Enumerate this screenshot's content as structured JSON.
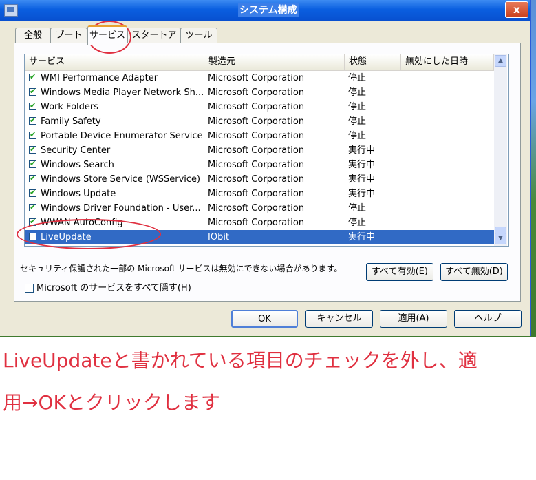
{
  "window": {
    "title": "システム構成",
    "close_label": "x"
  },
  "tabs": [
    {
      "label": "全般"
    },
    {
      "label": "ブート"
    },
    {
      "label": "サービス"
    },
    {
      "label": "スタートアップ"
    },
    {
      "label": "ツール"
    }
  ],
  "active_tab": "サービス",
  "table": {
    "columns": [
      "サービス",
      "製造元",
      "状態",
      "無効にした日時"
    ],
    "rows": [
      {
        "name": "WMI Performance Adapter",
        "manufacturer": "Microsoft Corporation",
        "status": "停止",
        "checked": true
      },
      {
        "name": "Windows Media Player Network Sh...",
        "manufacturer": "Microsoft Corporation",
        "status": "停止",
        "checked": true
      },
      {
        "name": "Work Folders",
        "manufacturer": "Microsoft Corporation",
        "status": "停止",
        "checked": true
      },
      {
        "name": "Family Safety",
        "manufacturer": "Microsoft Corporation",
        "status": "停止",
        "checked": true
      },
      {
        "name": "Portable Device Enumerator Service",
        "manufacturer": "Microsoft Corporation",
        "status": "停止",
        "checked": true
      },
      {
        "name": "Security Center",
        "manufacturer": "Microsoft Corporation",
        "status": "実行中",
        "checked": true
      },
      {
        "name": "Windows Search",
        "manufacturer": "Microsoft Corporation",
        "status": "実行中",
        "checked": true
      },
      {
        "name": "Windows Store Service (WSService)",
        "manufacturer": "Microsoft Corporation",
        "status": "実行中",
        "checked": true
      },
      {
        "name": "Windows Update",
        "manufacturer": "Microsoft Corporation",
        "status": "実行中",
        "checked": true
      },
      {
        "name": "Windows Driver Foundation - User...",
        "manufacturer": "Microsoft Corporation",
        "status": "停止",
        "checked": true
      },
      {
        "name": "WWAN AutoConfig",
        "manufacturer": "Microsoft Corporation",
        "status": "停止",
        "checked": true
      },
      {
        "name": "LiveUpdate",
        "manufacturer": "IObit",
        "status": "実行中",
        "checked": false
      }
    ],
    "selected_row": "LiveUpdate"
  },
  "note": "セキュリティ保護された一部の Microsoft サービスは無効にできない場合があります。",
  "buttons": {
    "enable_all": "すべて有効(E)",
    "disable_all": "すべて無効(D)",
    "ok": "OK",
    "cancel": "キャンセル",
    "apply": "適用(A)",
    "help": "ヘルプ"
  },
  "hide_ms_label": "Microsoft のサービスをすべて隠す(H)",
  "hide_ms_checked": false,
  "instruction": {
    "line1": "LiveUpdateと書かれている項目のチェックを外し、適",
    "line2": "用→OKとクリックします"
  },
  "colors": {
    "annotation": "#e03040",
    "selection": "#316ac5",
    "titlebar": "#0a5fe0"
  }
}
